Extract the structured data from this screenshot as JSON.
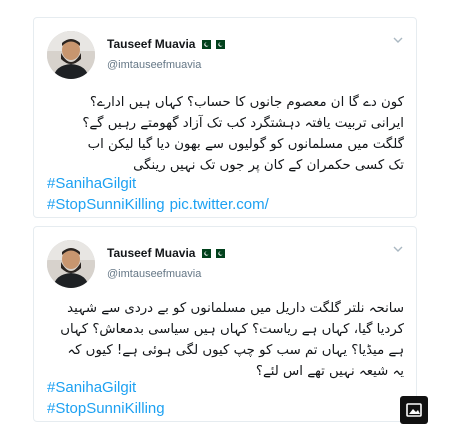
{
  "tweets": [
    {
      "author": "Tauseef Muavia",
      "flags": "🇵🇰 🇵🇰",
      "handle": "@imtauseefmuavia",
      "text_lines": [
        "کون دے گا ان معصوم جانوں کا حساب؟ کہاں ہیں ادارے؟",
        "ایرانی تربیت یافتہ دہشتگرد کب تک آزاد گھومتے رہیں گے؟",
        "گلگت میں مسلمانوں کو گولیوں سے بھون دیا گیا لیکن اب",
        "تک کسی حکمران کے کان پر جوں تک نہیں رینگی"
      ],
      "hashtags": [
        "#SanihaGilgit",
        "#StopSunniKilling"
      ],
      "pic_link": "pic.twitter.com/"
    },
    {
      "author": "Tauseef Muavia",
      "flags": "🇵🇰 🇵🇰",
      "handle": "@imtauseefmuavia",
      "text_lines": [
        "سانحہ نلتر گلگت داریل میں مسلمانوں کو بے دردی سے شہید",
        "کردیا گیا، کہاں ہے ریاست؟ کہاں ہیں سیاسی بدمعاش؟ کہاں",
        "ہے میڈیا؟ یہاں تم سب کو چپ کیوں لگی ہوئی ہے! کیوں کہ",
        "یہ شیعہ نہیں تھے اس لئے؟"
      ],
      "hashtags": [
        "#SanihaGilgit",
        "#StopSunniKilling"
      ],
      "pic_link": ""
    }
  ],
  "colors": {
    "link": "#1da1f2",
    "text": "#14171a",
    "handle": "#657786",
    "border": "#e6ecf0",
    "flag_green": "#01411c"
  },
  "icons": {
    "chevron": "chevron-down-icon",
    "image_badge": "image-icon",
    "flag": "pakistan-flag-icon"
  }
}
